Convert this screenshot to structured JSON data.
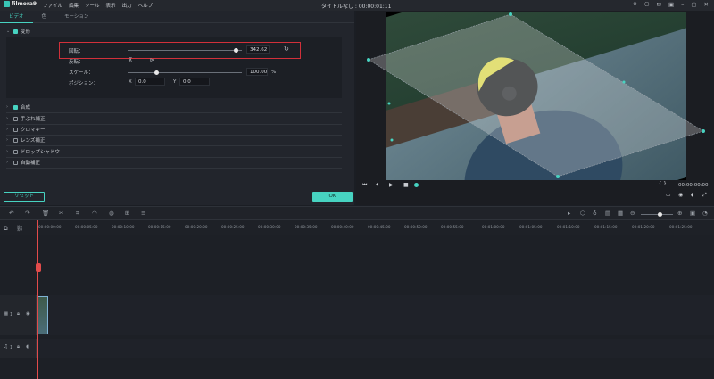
{
  "app": {
    "name": "filmora9",
    "window_title": "タイトルなし : 00:00:01:11"
  },
  "menu": [
    "ファイル",
    "編集",
    "ツール",
    "表示",
    "出力",
    "ヘルプ"
  ],
  "window_icons": [
    "user-icon",
    "gift-icon",
    "mail-icon",
    "save-icon",
    "minimize-icon",
    "maximize-icon",
    "close-icon"
  ],
  "tabs": [
    "ビデオ",
    "色",
    "モーション"
  ],
  "transform": {
    "section_label": "変形",
    "rotation_label": "回転：",
    "rotation_value": "342.62",
    "rotation_fraction": 0.95,
    "flip_label": "反転：",
    "scale_label": "スケール：",
    "scale_value": "100.00",
    "scale_unit": "%",
    "scale_fraction": 0.25,
    "position_label": "ポジション：",
    "x_label": "X",
    "x_value": "0.0",
    "y_label": "Y",
    "y_value": "0.0"
  },
  "sections": [
    "合成",
    "手ぶれ補正",
    "クロマキー",
    "レンズ補正",
    "ドロップシャドウ",
    "自動補正"
  ],
  "buttons": {
    "reset": "リセット",
    "ok": "OK"
  },
  "player": {
    "timecode": "00:00:00:00",
    "brackets": "{   }"
  },
  "ruler_ticks": [
    "00:00:00:00",
    "00:00:05:00",
    "00:00:10:00",
    "00:00:15:00",
    "00:00:20:00",
    "00:00:25:00",
    "00:00:30:00",
    "00:00:35:00",
    "00:00:40:00",
    "00:00:45:00",
    "00:00:50:00",
    "00:00:55:00",
    "00:01:00:00",
    "00:01:05:00",
    "00:01:10:00",
    "00:01:15:00",
    "00:01:20:00",
    "00:01:25:00"
  ],
  "tracks": {
    "video_label": "1",
    "audio_label": "1"
  },
  "colors": {
    "accent": "#47d3c1",
    "highlight": "#d1303a",
    "playhead": "#e24b4b"
  }
}
